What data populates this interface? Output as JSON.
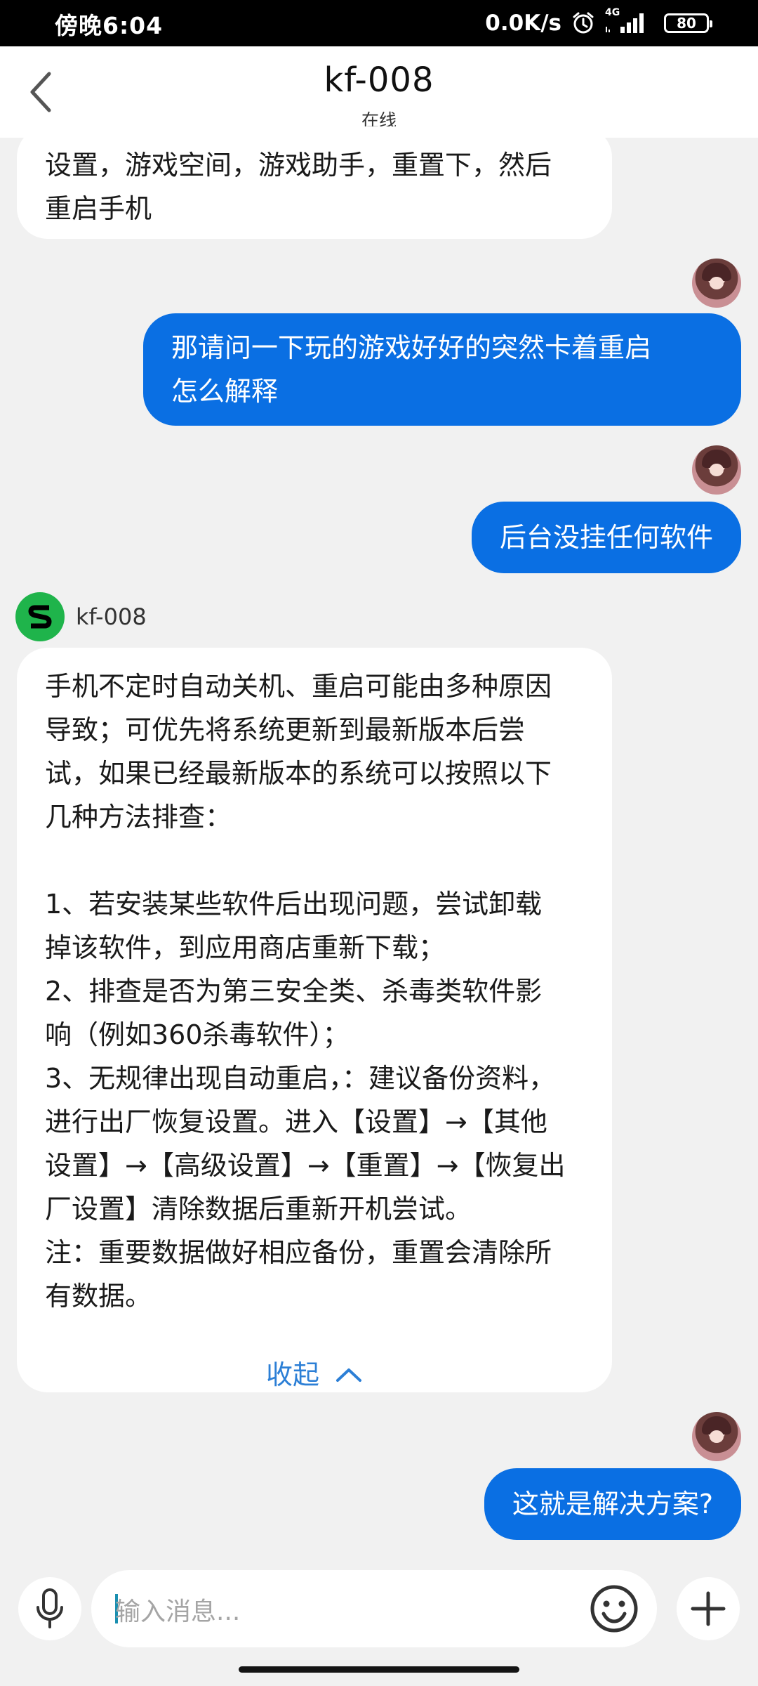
{
  "status_bar": {
    "time": "傍晚6:04",
    "net_speed": "0.0K/s",
    "network": "4G",
    "battery": "80"
  },
  "header": {
    "title": "kf-008",
    "status": "在线"
  },
  "messages": [
    {
      "from": "agent",
      "lines": [
        "设置，游戏空间，游戏助手，重置下，然后",
        "重启手机"
      ]
    },
    {
      "from": "user",
      "lines": [
        "那请问一下玩的游戏好好的突然卡着重启",
        "怎么解释"
      ]
    },
    {
      "from": "user",
      "lines": [
        "后台没挂任何软件"
      ]
    },
    {
      "from": "agent",
      "sender": "kf-008",
      "lines": [
        "手机不定时自动关机、重启可能由多种原因",
        "导致；可优先将系统更新到最新版本后尝",
        "试，如果已经最新版本的系统可以按照以下",
        "几种方法排查：",
        "",
        "1、若安装某些软件后出现问题，尝试卸载",
        "掉该软件，到应用商店重新下载；",
        "2、排查是否为第三安全类、杀毒类软件影",
        "响（例如360杀毒软件）；",
        "3、无规律出现自动重启，：建议备份资料，",
        "进行出厂恢复设置。进入【设置】→【其他",
        "设置】→【高级设置】→【重置】→【恢复出",
        "厂设置】清除数据后重新开机尝试。",
        "注：重要数据做好相应备份，重置会清除所",
        "有数据。"
      ],
      "collapse_label": "收起"
    },
    {
      "from": "user",
      "lines": [
        "这就是解决方案?"
      ]
    }
  ],
  "input": {
    "placeholder": "输入消息..."
  },
  "colors": {
    "user_bubble": "#0a6fe3",
    "agent_avatar": "#1fb44b",
    "link": "#2c7fd6"
  }
}
